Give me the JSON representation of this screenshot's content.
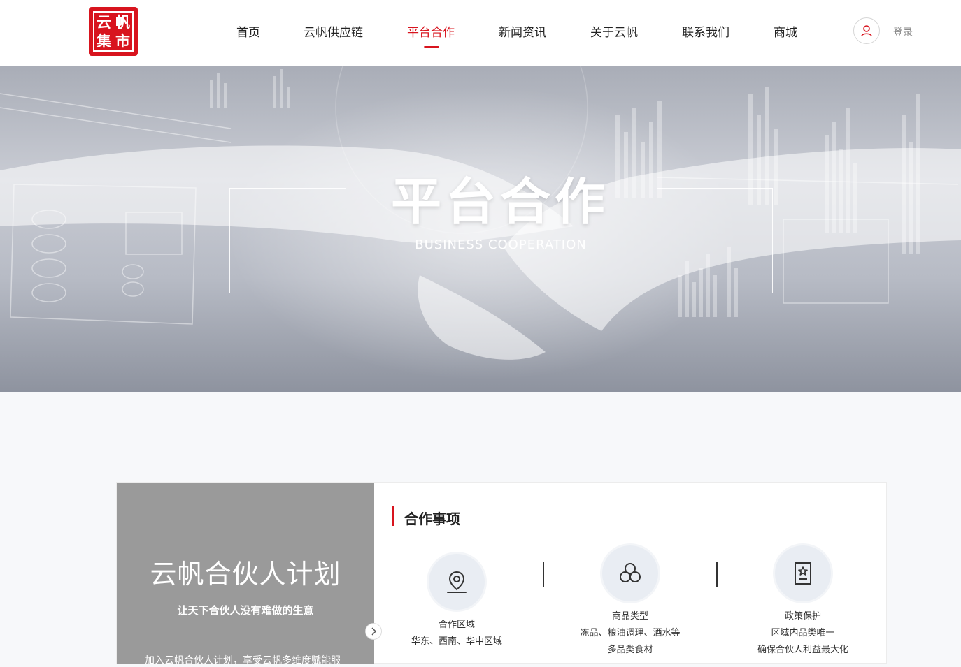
{
  "header": {
    "logo_chars": [
      "云",
      "帆",
      "集",
      "市"
    ],
    "nav": [
      {
        "label": "首页",
        "active": false
      },
      {
        "label": "云帆供应链",
        "active": false
      },
      {
        "label": "平台合作",
        "active": true
      },
      {
        "label": "新闻资讯",
        "active": false
      },
      {
        "label": "关于云帆",
        "active": false
      },
      {
        "label": "联系我们",
        "active": false
      },
      {
        "label": "商城",
        "active": false
      }
    ],
    "login_label": "登录",
    "user_icon": "user-icon"
  },
  "banner": {
    "title": "平台合作",
    "subtitle": "BUSINESS COOPERATION"
  },
  "partner_plan": {
    "title": "云帆合伙人计划",
    "slogan": "让天下合伙人没有难做的生意",
    "description": "加入云帆合伙人计划，享受云帆多维度赋能服"
  },
  "cooperation": {
    "section_title": "合作事项",
    "items": [
      {
        "icon": "location-icon",
        "lines": [
          "合作区域",
          "华东、西南、华中区域"
        ]
      },
      {
        "icon": "link-icon",
        "lines": [
          "商品类型",
          "冻品、粮油调理、酒水等",
          "多品类食材"
        ]
      },
      {
        "icon": "certificate-icon",
        "lines": [
          "政策保护",
          "区域内品类唯一",
          "确保合伙人利益最大化"
        ]
      }
    ]
  },
  "colors": {
    "brand_red": "#d8141e",
    "plan_panel": "#9a9a9a",
    "icon_circle": "#e9edf3"
  }
}
